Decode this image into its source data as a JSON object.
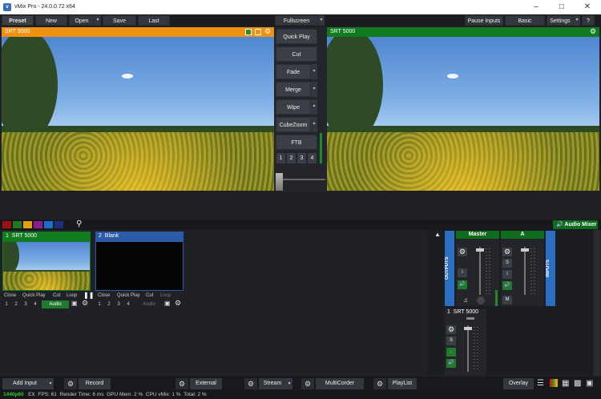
{
  "window": {
    "title": "vMix Pro - 24.0.0.72 x64",
    "logo": "v"
  },
  "toolbar": {
    "preset": "Preset",
    "new": "New",
    "open": "Open",
    "save": "Save",
    "last": "Last",
    "fullscreen": "Fullscreen",
    "pause_inputs": "Pause Inputs",
    "basic": "Basic",
    "settings": "Settings",
    "help": "?"
  },
  "preview": {
    "label": "SRT  5000"
  },
  "output": {
    "label": "SRT  5000"
  },
  "transitions": {
    "quick_play": "Quick Play",
    "cut": "Cut",
    "fade": "Fade",
    "merge": "Merge",
    "wipe": "Wipe",
    "cubezoom": "CubeZoom",
    "ftb": "FTB",
    "numbers": [
      "1",
      "2",
      "3",
      "4"
    ]
  },
  "colors": {
    "preview_accent": "#f0920e",
    "output_accent": "#0f7a1e",
    "tile_blue": "#2a5aa8",
    "swatches": [
      "#a01010",
      "#1e7a1e",
      "#e8a010",
      "#8a1e8a",
      "#1a6ec8",
      "#1e2e7a"
    ]
  },
  "inputs": [
    {
      "number": "1",
      "name": "SRT  5000",
      "links": [
        "Close",
        "Quick Play",
        "Cut",
        "Loop"
      ],
      "nums": [
        "1",
        "2",
        "3",
        "4"
      ],
      "audio": "Audio"
    },
    {
      "number": "2",
      "name": "Blank",
      "links": [
        "Close",
        "Quick Play",
        "Cut",
        "Loop"
      ],
      "nums": [
        "1",
        "2",
        "3",
        "4"
      ],
      "audio": "Audio"
    }
  ],
  "mixer": {
    "audio_mixer": "Audio Mixer",
    "outputs": "OUTPUTS",
    "inputs": "INPUTS",
    "master": "Master",
    "bus_a": "A",
    "i_label": "i",
    "s_label": "S",
    "m_label": "M",
    "input1": "1",
    "input1_name": "SRT  5000"
  },
  "bottom_toolbar": {
    "add_input": "Add Input",
    "record": "Record",
    "external": "External",
    "stream": "Stream",
    "multicorder": "MultiCorder",
    "playlist": "PlayList",
    "overlay": "Overlay"
  },
  "status": {
    "resolution": "1440p60",
    "ex": "EX",
    "fps_label": "FPS:",
    "fps": "61",
    "render_label": "Render Time:",
    "render": "6 ms",
    "gpu_label": "GPU Mem:",
    "gpu": "2 %",
    "cpu_label": "CPU vMix:",
    "cpu": "1 %",
    "total_label": "Total:",
    "total": "2 %"
  }
}
